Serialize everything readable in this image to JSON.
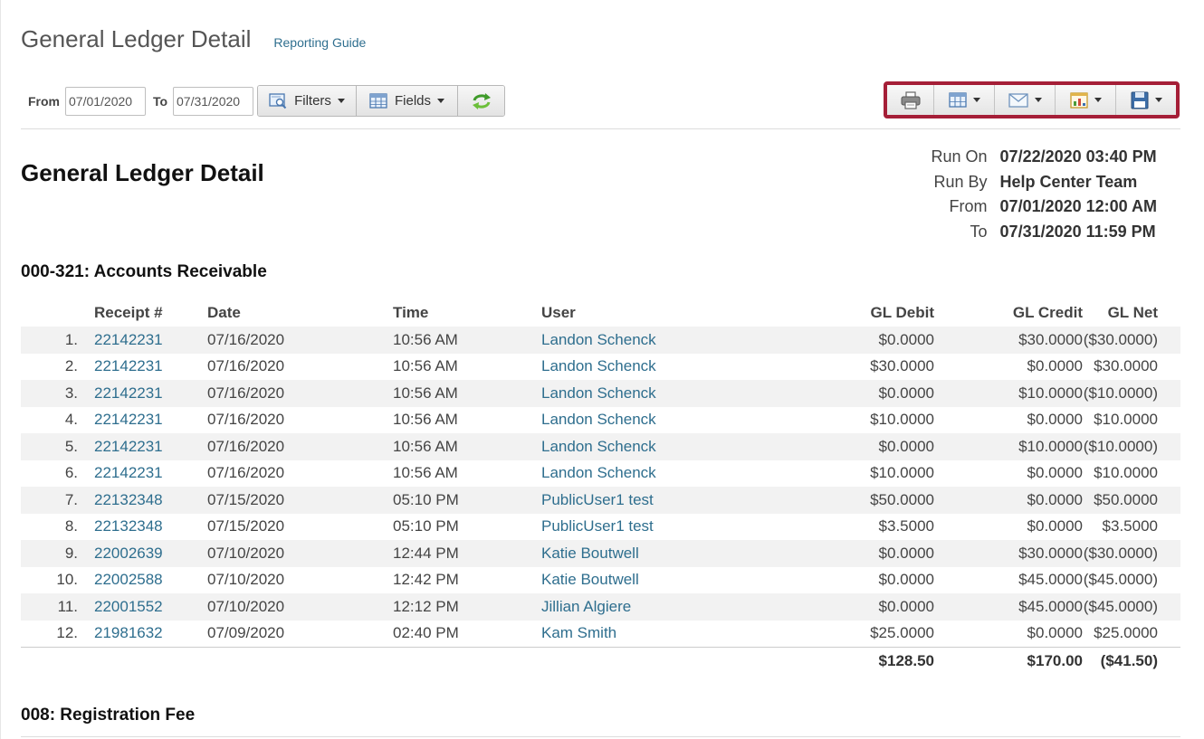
{
  "header": {
    "page_title": "General Ledger Detail",
    "guide_link": "Reporting Guide"
  },
  "toolbar": {
    "from_label": "From",
    "from_value": "07/01/2020",
    "to_label": "To",
    "to_value": "07/31/2020",
    "filters_label": "Filters",
    "fields_label": "Fields",
    "icons": [
      "filter-icon",
      "fields-icon",
      "refresh-icon",
      "print-icon",
      "grid-icon",
      "email-icon",
      "chart-icon",
      "save-icon"
    ],
    "highlight_color": "#a51e37"
  },
  "report": {
    "title": "General Ledger Detail",
    "meta": [
      {
        "key": "Run On",
        "value": "07/22/2020 03:40 PM"
      },
      {
        "key": "Run By",
        "value": "Help Center Team"
      },
      {
        "key": "From",
        "value": "07/01/2020 12:00 AM"
      },
      {
        "key": "To",
        "value": "07/31/2020 11:59 PM"
      }
    ]
  },
  "sections": [
    {
      "title": "000-321: Accounts Receivable",
      "columns": [
        "Receipt #",
        "Date",
        "Time",
        "User",
        "GL Debit",
        "GL Credit",
        "GL Net"
      ],
      "rows": [
        {
          "n": "1.",
          "receipt": "22142231",
          "date": "07/16/2020",
          "time": "10:56 AM",
          "user": "Landon Schenck",
          "debit": "$0.0000",
          "credit": "$30.0000",
          "net": "($30.0000)"
        },
        {
          "n": "2.",
          "receipt": "22142231",
          "date": "07/16/2020",
          "time": "10:56 AM",
          "user": "Landon Schenck",
          "debit": "$30.0000",
          "credit": "$0.0000",
          "net": "$30.0000"
        },
        {
          "n": "3.",
          "receipt": "22142231",
          "date": "07/16/2020",
          "time": "10:56 AM",
          "user": "Landon Schenck",
          "debit": "$0.0000",
          "credit": "$10.0000",
          "net": "($10.0000)"
        },
        {
          "n": "4.",
          "receipt": "22142231",
          "date": "07/16/2020",
          "time": "10:56 AM",
          "user": "Landon Schenck",
          "debit": "$10.0000",
          "credit": "$0.0000",
          "net": "$10.0000"
        },
        {
          "n": "5.",
          "receipt": "22142231",
          "date": "07/16/2020",
          "time": "10:56 AM",
          "user": "Landon Schenck",
          "debit": "$0.0000",
          "credit": "$10.0000",
          "net": "($10.0000)"
        },
        {
          "n": "6.",
          "receipt": "22142231",
          "date": "07/16/2020",
          "time": "10:56 AM",
          "user": "Landon Schenck",
          "debit": "$10.0000",
          "credit": "$0.0000",
          "net": "$10.0000"
        },
        {
          "n": "7.",
          "receipt": "22132348",
          "date": "07/15/2020",
          "time": "05:10 PM",
          "user": "PublicUser1 test",
          "debit": "$50.0000",
          "credit": "$0.0000",
          "net": "$50.0000"
        },
        {
          "n": "8.",
          "receipt": "22132348",
          "date": "07/15/2020",
          "time": "05:10 PM",
          "user": "PublicUser1 test",
          "debit": "$3.5000",
          "credit": "$0.0000",
          "net": "$3.5000"
        },
        {
          "n": "9.",
          "receipt": "22002639",
          "date": "07/10/2020",
          "time": "12:44 PM",
          "user": "Katie Boutwell",
          "debit": "$0.0000",
          "credit": "$30.0000",
          "net": "($30.0000)"
        },
        {
          "n": "10.",
          "receipt": "22002588",
          "date": "07/10/2020",
          "time": "12:42 PM",
          "user": "Katie Boutwell",
          "debit": "$0.0000",
          "credit": "$45.0000",
          "net": "($45.0000)"
        },
        {
          "n": "11.",
          "receipt": "22001552",
          "date": "07/10/2020",
          "time": "12:12 PM",
          "user": "Jillian Algiere",
          "debit": "$0.0000",
          "credit": "$45.0000",
          "net": "($45.0000)"
        },
        {
          "n": "12.",
          "receipt": "21981632",
          "date": "07/09/2020",
          "time": "02:40 PM",
          "user": "Kam Smith",
          "debit": "$25.0000",
          "credit": "$0.0000",
          "net": "$25.0000"
        }
      ],
      "totals": {
        "debit": "$128.50",
        "credit": "$170.00",
        "net": "($41.50)"
      }
    },
    {
      "title": "008: Registration Fee"
    }
  ]
}
